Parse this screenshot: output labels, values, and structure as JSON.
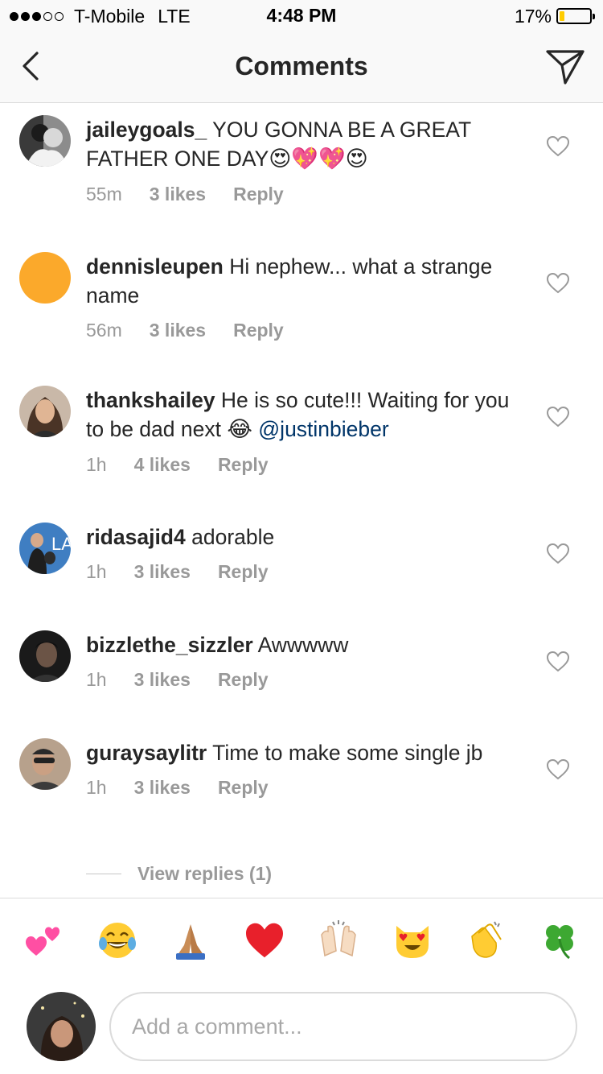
{
  "status_bar": {
    "carrier": "T-Mobile",
    "network": "LTE",
    "time": "4:48 PM",
    "battery_text": "17%",
    "battery_level": 0.17,
    "signal_bars": 3
  },
  "nav": {
    "title": "Comments",
    "back_icon": "chevron-left-icon",
    "send_icon": "paper-plane-icon"
  },
  "comments": [
    {
      "username": "jaileygoals_",
      "text": "YOU GONNA BE A GREAT FATHER ONE DAY",
      "emoji": "😍💖💖😍",
      "time": "55m",
      "likes": "3 likes",
      "reply": "Reply"
    },
    {
      "username": "dennisleupen",
      "text": "Hi nephew... what a strange name",
      "time": "56m",
      "likes": "3 likes",
      "reply": "Reply"
    },
    {
      "username": "thankshailey",
      "text": "He is so cute!!! Waiting for you to be dad next",
      "emoji": "😂",
      "mention": "@justinbieber",
      "time": "1h",
      "likes": "4 likes",
      "reply": "Reply"
    },
    {
      "username": "ridasajid4",
      "text": "adorable",
      "time": "1h",
      "likes": "3 likes",
      "reply": "Reply"
    },
    {
      "username": "bizzlethe_sizzler",
      "text": "Awwwww",
      "time": "1h",
      "likes": "3 likes",
      "reply": "Reply"
    },
    {
      "username": "guraysaylitr",
      "text": "Time to make some single jb",
      "time": "1h",
      "likes": "3 likes",
      "reply": "Reply"
    }
  ],
  "view_replies": "View replies (1)",
  "quick_emojis": [
    {
      "name": "two-hearts-icon",
      "color": "#ff4fa3"
    },
    {
      "name": "tears-of-joy-icon",
      "color": "#ffcc33"
    },
    {
      "name": "folded-hands-icon",
      "color": "#c98d57"
    },
    {
      "name": "red-heart-icon",
      "color": "#e8202b"
    },
    {
      "name": "raised-hands-icon",
      "color": "#f6dcc2"
    },
    {
      "name": "heart-eyes-cat-icon",
      "color": "#ffcc33"
    },
    {
      "name": "clapping-hands-icon",
      "color": "#ffcc33"
    },
    {
      "name": "four-leaf-clover-icon",
      "color": "#3da832"
    }
  ],
  "input": {
    "placeholder": "Add a comment..."
  },
  "colors": {
    "text": "#262626",
    "secondary": "#999999",
    "mention": "#003569",
    "divider": "#dbdbdb"
  }
}
